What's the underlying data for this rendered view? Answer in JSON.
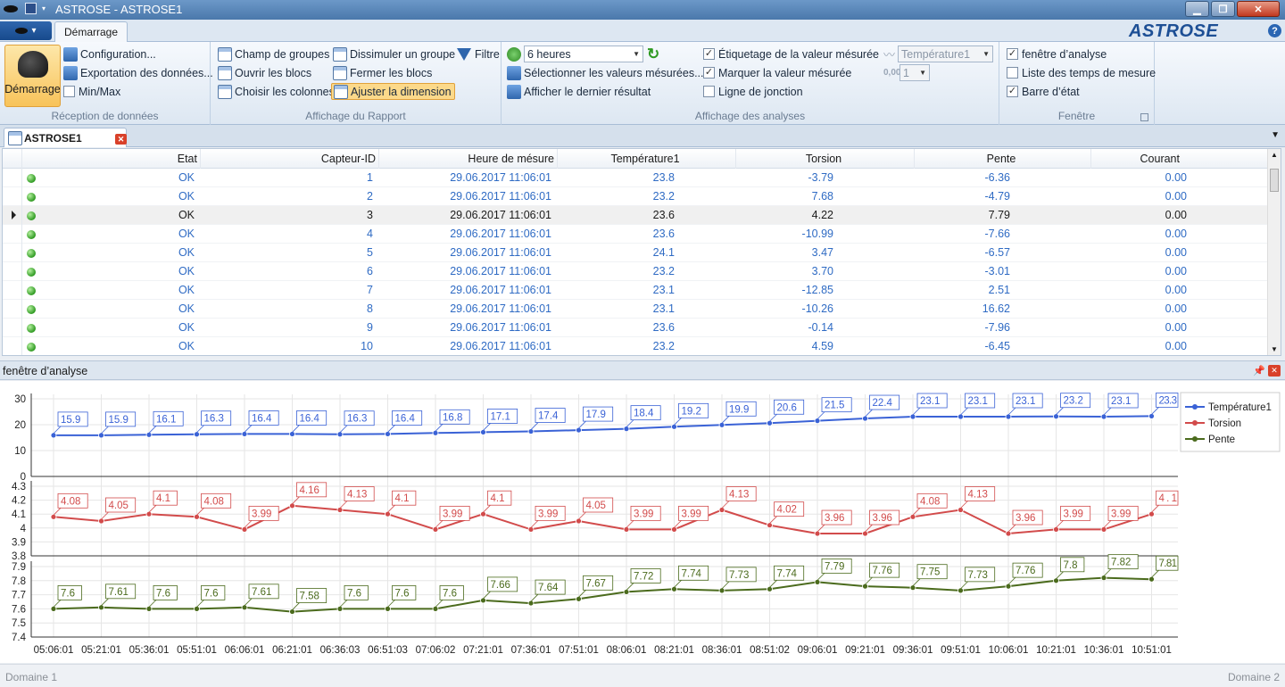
{
  "window": {
    "title": "ASTROSE - ASTROSE1"
  },
  "ribbon": {
    "tab": "Démarrage",
    "brand": "ASTROSE",
    "groups": {
      "reception": {
        "label": "Réception de données",
        "start": "Démarrage",
        "config": "Configuration...",
        "export": "Exportation des données...",
        "minmax": "Min/Max"
      },
      "rapport": {
        "label": "Affichage du Rapport",
        "champ": "Champ de groupes",
        "ouvrir": "Ouvrir les blocs",
        "choisir": "Choisir les colonnes",
        "dissimuler": "Dissimuler un groupe",
        "fermer": "Fermer les blocs",
        "ajuster": "Ajuster la dimension",
        "filtre": "Filtre"
      },
      "analyses": {
        "label": "Affichage des analyses",
        "range": "6 heures",
        "select_values": "Sélectionner les valeurs mésurées...",
        "last_result": "Afficher le dernier résultat",
        "etiquetage": "Étiquetage de la valeur mésurée",
        "marquer": "Marquer la valeur mésurée",
        "ligne": "Ligne de jonction",
        "series_combo": "Température1",
        "decimals_combo": "1"
      },
      "fenetre": {
        "label": "Fenêtre",
        "analyse": "fenêtre d’analyse",
        "liste": "Liste des temps de mesure",
        "barre": "Barre d’état"
      }
    }
  },
  "document": {
    "tab": "ASTROSE1"
  },
  "grid": {
    "columns": [
      "Etat",
      "Capteur-ID",
      "Heure de mésure",
      "Température1",
      "Torsion",
      "Pente",
      "Courant"
    ],
    "rows": [
      [
        "OK",
        "1",
        "29.06.2017 11:06:01",
        "23.8",
        "-3.79",
        "-6.36",
        "0.00"
      ],
      [
        "OK",
        "2",
        "29.06.2017 11:06:01",
        "23.2",
        "7.68",
        "-4.79",
        "0.00"
      ],
      [
        "OK",
        "3",
        "29.06.2017 11:06:01",
        "23.6",
        "4.22",
        "7.79",
        "0.00"
      ],
      [
        "OK",
        "4",
        "29.06.2017 11:06:01",
        "23.6",
        "-10.99",
        "-7.66",
        "0.00"
      ],
      [
        "OK",
        "5",
        "29.06.2017 11:06:01",
        "24.1",
        "3.47",
        "-6.57",
        "0.00"
      ],
      [
        "OK",
        "6",
        "29.06.2017 11:06:01",
        "23.2",
        "3.70",
        "-3.01",
        "0.00"
      ],
      [
        "OK",
        "7",
        "29.06.2017 11:06:01",
        "23.1",
        "-12.85",
        "2.51",
        "0.00"
      ],
      [
        "OK",
        "8",
        "29.06.2017 11:06:01",
        "23.1",
        "-10.26",
        "16.62",
        "0.00"
      ],
      [
        "OK",
        "9",
        "29.06.2017 11:06:01",
        "23.6",
        "-0.14",
        "-7.96",
        "0.00"
      ],
      [
        "OK",
        "10",
        "29.06.2017 11:06:01",
        "23.2",
        "4.59",
        "-6.45",
        "0.00"
      ]
    ],
    "selected_row": 2
  },
  "analysis": {
    "title": "fenêtre d’analyse"
  },
  "chart_data": {
    "type": "line",
    "x": [
      "05:06:01",
      "05:21:01",
      "05:36:01",
      "05:51:01",
      "06:06:01",
      "06:21:01",
      "06:36:03",
      "06:51:03",
      "07:06:02",
      "07:21:01",
      "07:36:01",
      "07:51:01",
      "08:06:01",
      "08:21:01",
      "08:36:01",
      "08:51:02",
      "09:06:01",
      "09:21:01",
      "09:36:01",
      "09:51:01",
      "10:06:01",
      "10:21:01",
      "10:36:01",
      "10:51:01"
    ],
    "legend_position": "top-right",
    "grid": true,
    "series": [
      {
        "name": "Température1",
        "color": "#3a62d6",
        "ylim": [
          0,
          30
        ],
        "yticks": [
          "0",
          "10",
          "20",
          "30"
        ],
        "values": [
          15.9,
          15.9,
          16.1,
          16.3,
          16.4,
          16.4,
          16.3,
          16.4,
          16.8,
          17.1,
          17.4,
          17.9,
          18.4,
          19.2,
          19.9,
          20.6,
          21.5,
          22.4,
          23.1,
          23.1,
          23.1,
          23.2,
          23.1,
          23.3
        ]
      },
      {
        "name": "Torsion",
        "color": "#d24b4b",
        "ylim": [
          3.8,
          4.3
        ],
        "yticks": [
          "3.8",
          "3.9",
          "4",
          "4.1",
          "4.2",
          "4.3"
        ],
        "values": [
          4.08,
          4.05,
          4.1,
          4.08,
          3.99,
          4.16,
          4.13,
          4.1,
          3.99,
          4.1,
          3.99,
          4.05,
          3.99,
          3.99,
          4.13,
          4.02,
          3.96,
          3.96,
          4.08,
          4.13,
          3.96,
          3.99,
          3.99,
          4.1
        ]
      },
      {
        "name": "Pente",
        "color": "#4b6b1d",
        "ylim": [
          7.4,
          7.9
        ],
        "yticks": [
          "7.4",
          "7.5",
          "7.6",
          "7.7",
          "7.8",
          "7.9"
        ],
        "values": [
          7.6,
          7.61,
          7.6,
          7.6,
          7.61,
          7.58,
          7.6,
          7.6,
          7.6,
          7.66,
          7.64,
          7.67,
          7.72,
          7.74,
          7.73,
          7.74,
          7.79,
          7.76,
          7.75,
          7.73,
          7.76,
          7.8,
          7.82,
          7.81
        ]
      }
    ]
  },
  "status": {
    "left": "Domaine 1",
    "right": "Domaine 2"
  }
}
